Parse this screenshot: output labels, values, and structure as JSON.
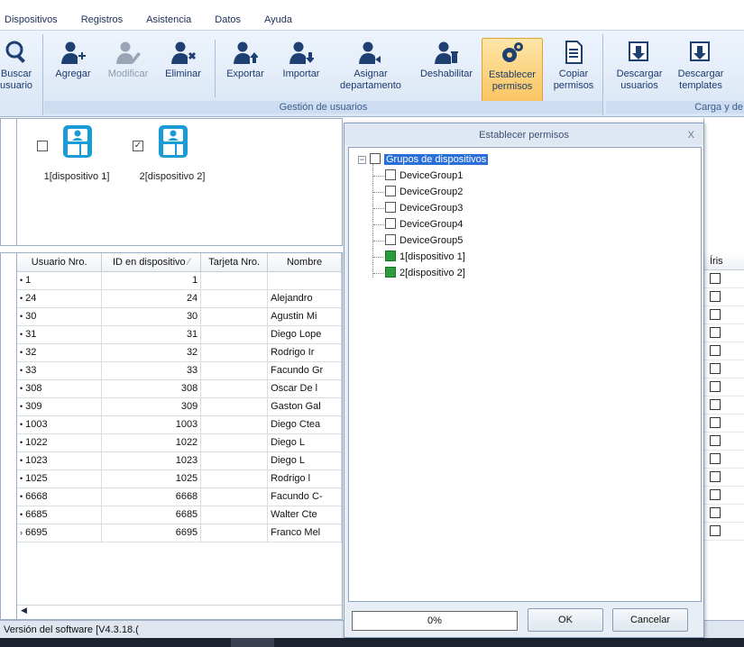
{
  "menu": [
    "Dispositivos",
    "Registros",
    "Asistencia",
    "Datos",
    "Ayuda"
  ],
  "ribbon": {
    "search": [
      "Buscar",
      "usuario"
    ],
    "user_buttons": [
      {
        "label": [
          "Agregar"
        ],
        "icon": "user-add-icon",
        "disabled": false
      },
      {
        "label": [
          "Modificar"
        ],
        "icon": "user-edit-icon",
        "disabled": true
      },
      {
        "label": [
          "Eliminar"
        ],
        "icon": "user-delete-icon",
        "disabled": false
      },
      {
        "label": [
          "Exportar"
        ],
        "icon": "user-export-icon",
        "disabled": false
      },
      {
        "label": [
          "Importar"
        ],
        "icon": "user-import-icon",
        "disabled": false
      },
      {
        "label": [
          "Asignar",
          "departamento"
        ],
        "icon": "user-department-icon",
        "disabled": false
      },
      {
        "label": [
          "Deshabilitar"
        ],
        "icon": "user-disable-icon",
        "disabled": false
      },
      {
        "label": [
          "Establecer",
          "permisos"
        ],
        "icon": "gears-icon",
        "disabled": false,
        "active": true
      },
      {
        "label": [
          "Copiar",
          "permisos"
        ],
        "icon": "copy-document-icon",
        "disabled": false
      }
    ],
    "group_users_label": "Gestión de usuarios",
    "load_buttons": [
      {
        "label": [
          "Descargar",
          "usuarios"
        ],
        "icon": "download-users-icon"
      },
      {
        "label": [
          "Descargar",
          "templates"
        ],
        "icon": "download-templates-icon"
      }
    ],
    "group_load_label": "Carga y de"
  },
  "devices": [
    {
      "label": "1[dispositivo 1]",
      "checked": false
    },
    {
      "label": "2[dispositivo 2]",
      "checked": true
    }
  ],
  "table": {
    "columns": [
      "Usuario Nro.",
      "ID en dispositivo",
      "Tarjeta Nro.",
      "Nombre"
    ],
    "rows": [
      [
        "1",
        "1",
        "",
        ""
      ],
      [
        "24",
        "24",
        "",
        "Alejandro"
      ],
      [
        "30",
        "30",
        "",
        "Agustin Mi"
      ],
      [
        "31",
        "31",
        "",
        "Diego Lope"
      ],
      [
        "32",
        "32",
        "",
        "Rodrigo Ir"
      ],
      [
        "33",
        "33",
        "",
        "Facundo Gr"
      ],
      [
        "308",
        "308",
        "",
        "Oscar De l"
      ],
      [
        "309",
        "309",
        "",
        "Gaston Gal"
      ],
      [
        "1003",
        "1003",
        "",
        "Diego Ctea"
      ],
      [
        "1022",
        "1022",
        "",
        "Diego L"
      ],
      [
        "1023",
        "1023",
        "",
        "Diego L"
      ],
      [
        "1025",
        "1025",
        "",
        "Rodrigo l"
      ],
      [
        "6668",
        "6668",
        "",
        "Facundo C-"
      ],
      [
        "6685",
        "6685",
        "",
        "Walter Cte"
      ],
      [
        "6695",
        "6695",
        "",
        "Franco Mel"
      ]
    ],
    "iris_header": "Íris"
  },
  "status": "Versión del software  [V4.3.18.(",
  "dialog": {
    "title": "Establecer permisos",
    "close": "X",
    "root": "Grupos de dispositivos",
    "items": [
      {
        "label": "DeviceGroup1",
        "checked": false
      },
      {
        "label": "DeviceGroup2",
        "checked": false
      },
      {
        "label": "DeviceGroup3",
        "checked": false
      },
      {
        "label": "DeviceGroup4",
        "checked": false
      },
      {
        "label": "DeviceGroup5",
        "checked": false
      },
      {
        "label": "1[dispositivo 1]",
        "checked": true
      },
      {
        "label": "2[dispositivo 2]",
        "checked": true
      }
    ],
    "progress": "0%",
    "ok": "OK",
    "cancel": "Cancelar"
  },
  "colors": {
    "accent": "#2a6fd8",
    "selected_button": "#f9c462",
    "checked_green": "#2b9c3a"
  }
}
